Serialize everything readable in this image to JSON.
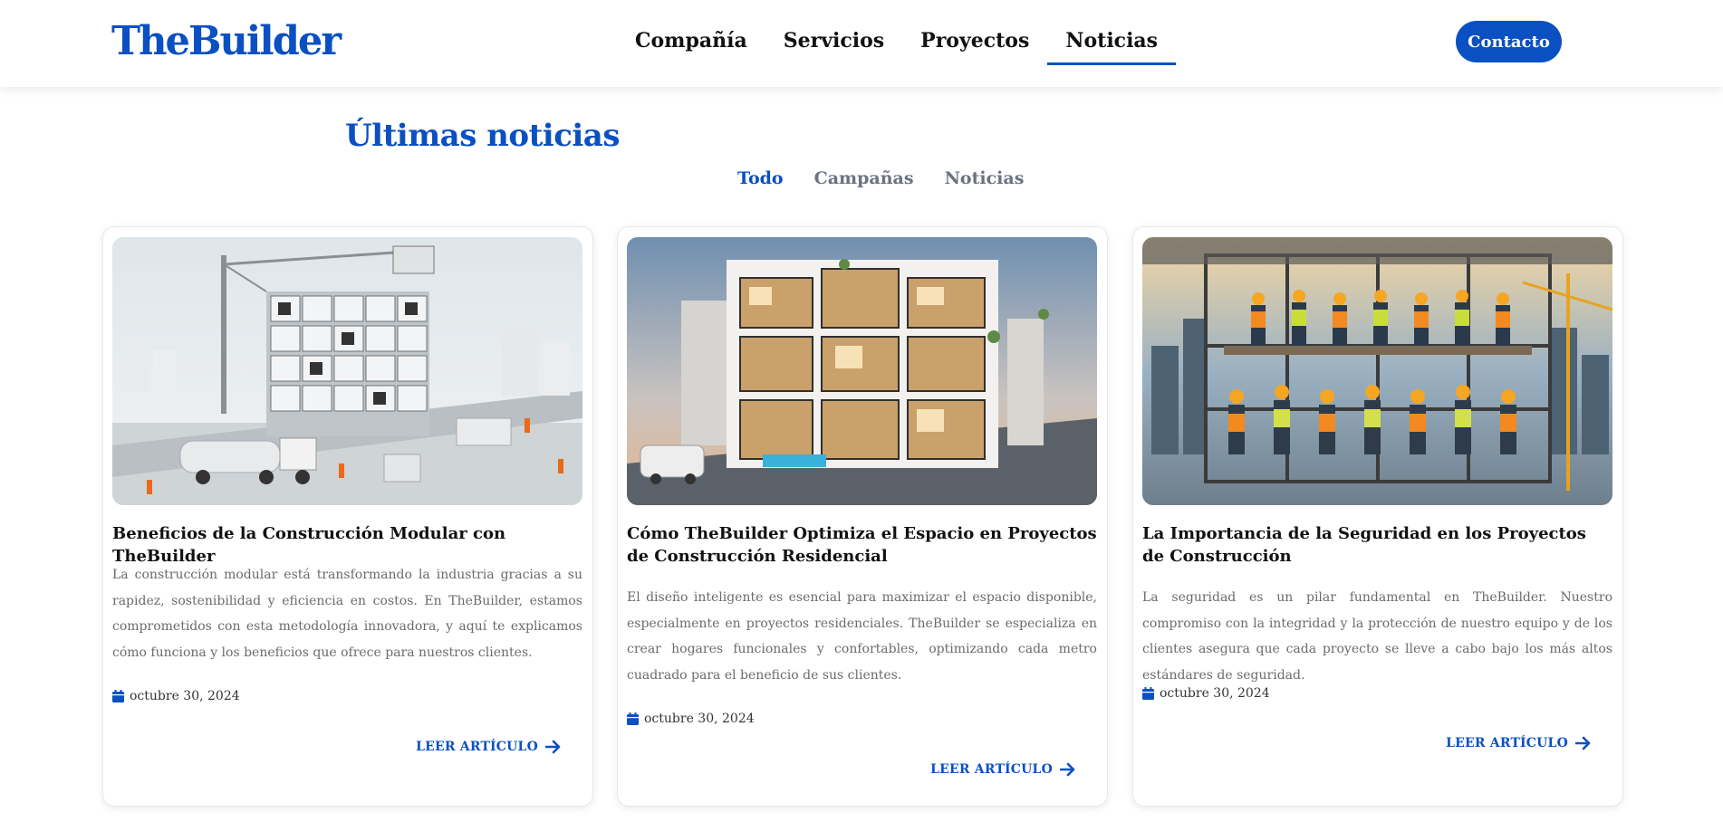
{
  "header": {
    "logo": "TheBuilder",
    "nav": [
      {
        "label": "Compañía",
        "active": false
      },
      {
        "label": "Servicios",
        "active": false
      },
      {
        "label": "Proyectos",
        "active": false
      },
      {
        "label": "Noticias",
        "active": true
      }
    ],
    "contact_label": "Contacto"
  },
  "section": {
    "title": "Últimas noticias",
    "filters": [
      {
        "label": "Todo",
        "active": true
      },
      {
        "label": "Campañas",
        "active": false
      },
      {
        "label": "Noticias",
        "active": false
      }
    ]
  },
  "cards": [
    {
      "image_icon": "modular-construction-image",
      "title": "Beneficios de la Construcción Modular con TheBuilder",
      "text": "La construcción modular está transformando la industria gracias a su rapidez, sostenibilidad y eficiencia en costos. En TheBuilder, estamos comprometidos con esta metodología innovadora, y aquí te explicamos cómo funciona y los beneficios que ofrece para nuestros clientes.",
      "date": "octubre 30, 2024",
      "read_more": "LEER ARTÍCULO"
    },
    {
      "image_icon": "residential-building-image",
      "title": "Cómo TheBuilder Optimiza el Espacio en Proyectos de Construcción Residencial",
      "text": "El diseño inteligente es esencial para maximizar el espacio disponible, especialmente en proyectos residenciales. TheBuilder se especializa en crear hogares funcionales y confortables, optimizando cada metro cuadrado para el beneficio de sus clientes.",
      "date": "octubre 30, 2024",
      "read_more": "LEER ARTÍCULO"
    },
    {
      "image_icon": "safety-workers-image",
      "title": "La Importancia de la Seguridad en los Proyectos de Construcción",
      "text": "La seguridad es un pilar fundamental en TheBuilder. Nuestro compromiso con la integridad y la protección de nuestro equipo y de los clientes asegura que cada proyecto se lleve a cabo bajo los más altos estándares de seguridad.",
      "date": "octubre 30, 2024",
      "read_more": "LEER ARTÍCULO"
    }
  ],
  "colors": {
    "accent": "#0a50c2",
    "muted": "#6b7280",
    "text": "#111111"
  }
}
